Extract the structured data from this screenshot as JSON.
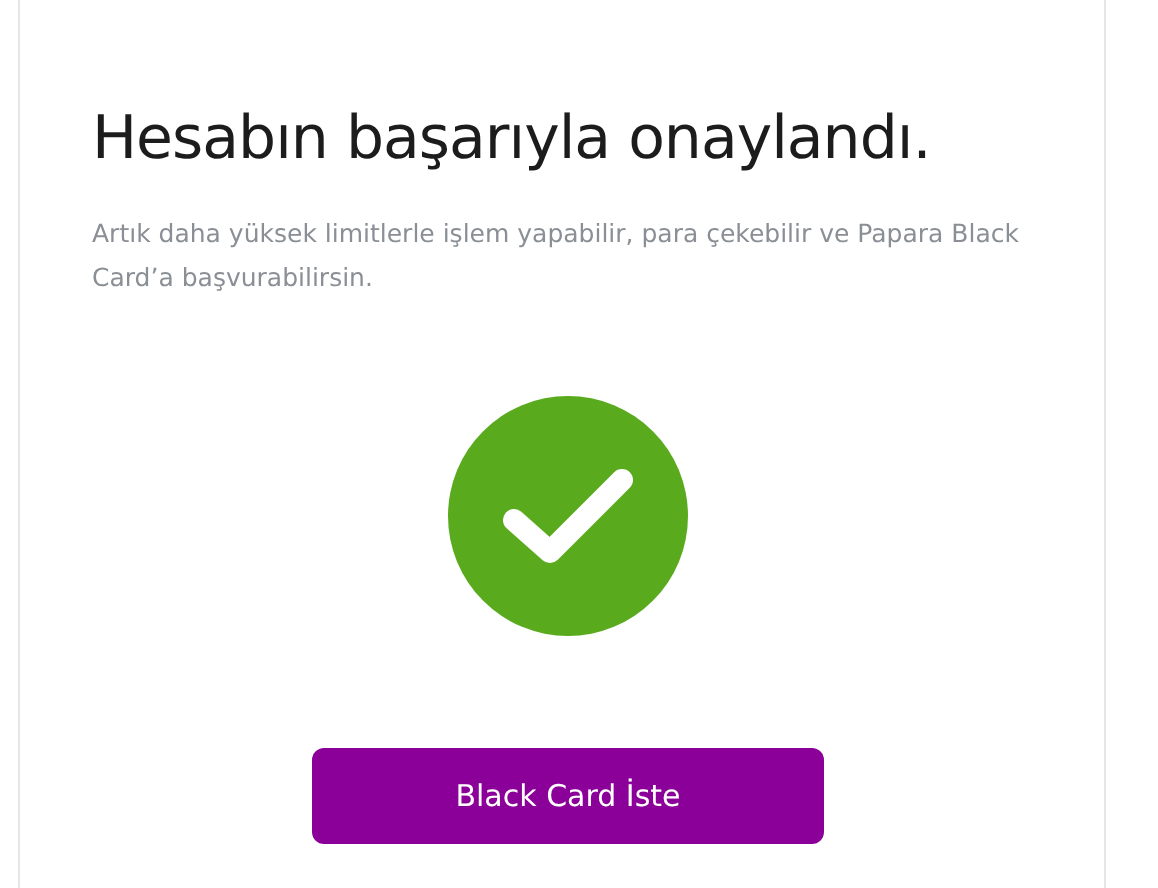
{
  "title": "Hesabın başarıyla onaylandı.",
  "message": "Artık daha yüksek limitlerle işlem yapabilir, para çekebilir ve Papara Black Card’a başvurabilirsin.",
  "status": {
    "kind": "success",
    "color": "#5aaa1e"
  },
  "button": {
    "label": "Black Card İste"
  }
}
